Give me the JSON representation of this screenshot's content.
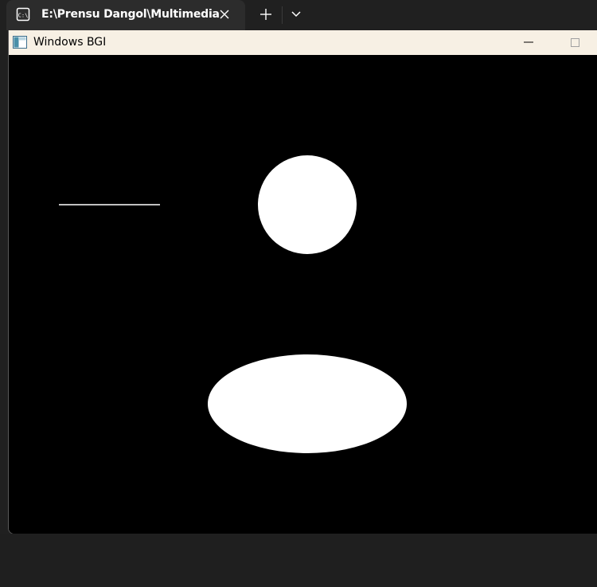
{
  "terminal": {
    "tab_title": "E:\\Prensu Dangol\\Multimedia",
    "tab_icon": "console-icon",
    "close_icon": "close-icon",
    "new_tab_icon": "plus-icon",
    "dropdown_icon": "chevron-down-icon"
  },
  "bgi_window": {
    "title": "Windows BGI",
    "app_icon": "window-app-icon",
    "minimize_icon": "minimize-icon",
    "maximize_icon": "maximize-icon"
  },
  "colors": {
    "terminal_bg": "#202020",
    "tab_bg": "#2c2c2c",
    "bgi_titlebar_bg": "#f7f0e4",
    "canvas_bg": "#000000",
    "drawing_color": "#ffffff"
  },
  "canvas_shapes": [
    "line",
    "filled-circle",
    "filled-ellipse"
  ]
}
